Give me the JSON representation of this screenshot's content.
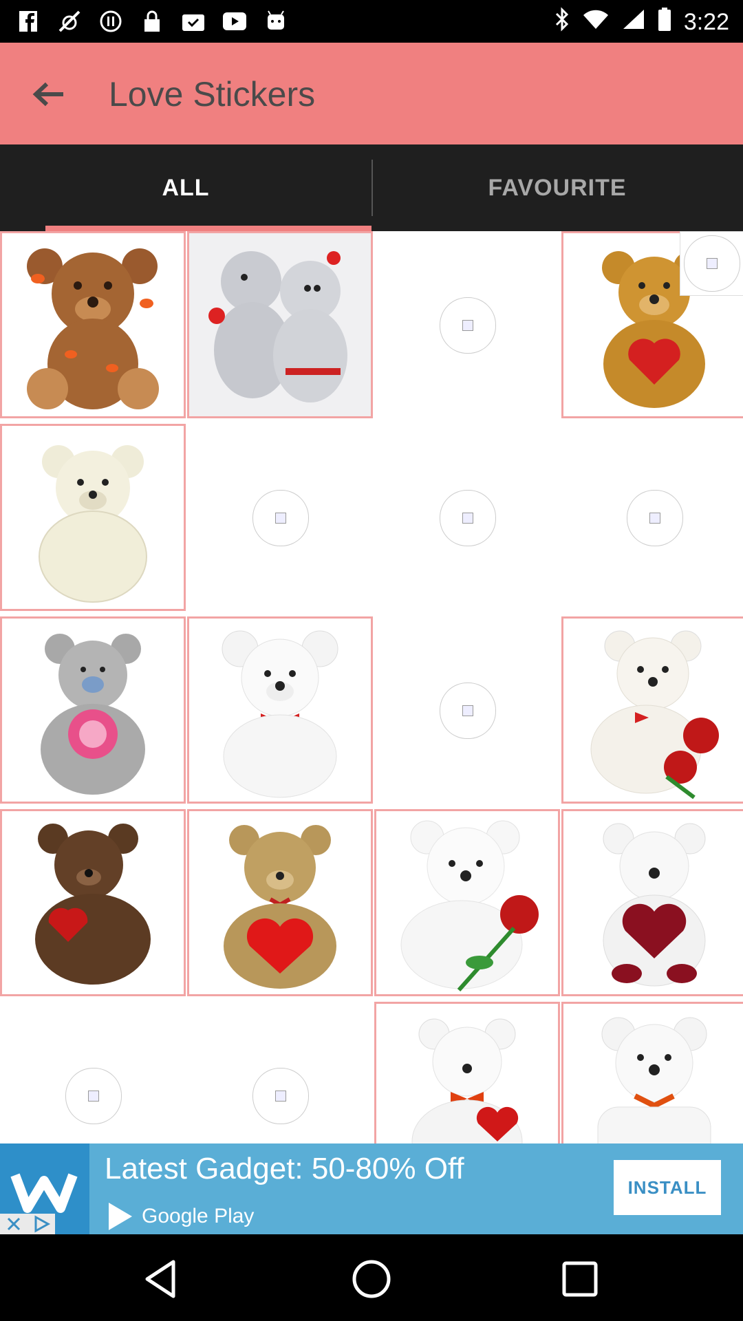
{
  "status_bar": {
    "time": "3:22",
    "icons": [
      "facebook-icon",
      "fake-gps-icon",
      "alert-icon",
      "lock-icon",
      "task-icon",
      "youtube-icon",
      "android-icon",
      "bluetooth-icon",
      "wifi-icon",
      "signal-icon",
      "battery-icon"
    ]
  },
  "app_bar": {
    "title": "Love Stickers",
    "back_icon": "arrow-back-icon",
    "color": "#F08080"
  },
  "tabs": [
    {
      "label": "ALL",
      "selected": true
    },
    {
      "label": "FAVOURITE",
      "selected": false
    }
  ],
  "grid": {
    "columns": 4,
    "cells": [
      "bear-brown-kisses",
      "bears-hugging",
      "broken-image",
      "bear-i-love-you-heart",
      "bear-cream",
      "broken-image",
      "broken-image",
      "broken-image",
      "bear-grey-love-you",
      "bear-white-bow",
      "broken-image",
      "bear-white-roses",
      "bear-brown-be-mine",
      "bear-tan-i-love-you",
      "bear-white-rose",
      "bear-white-red-heart",
      "broken-image",
      "broken-image",
      "bear-white-be-mine",
      "bear-i-need-a-big-hug"
    ]
  },
  "ad": {
    "title": "Latest Gadget: 50-80% Off",
    "store": "Google Play",
    "install_label": "INSTALL"
  },
  "nav_bar": {
    "icons": [
      "back-triangle-icon",
      "home-circle-icon",
      "recents-square-icon"
    ]
  }
}
